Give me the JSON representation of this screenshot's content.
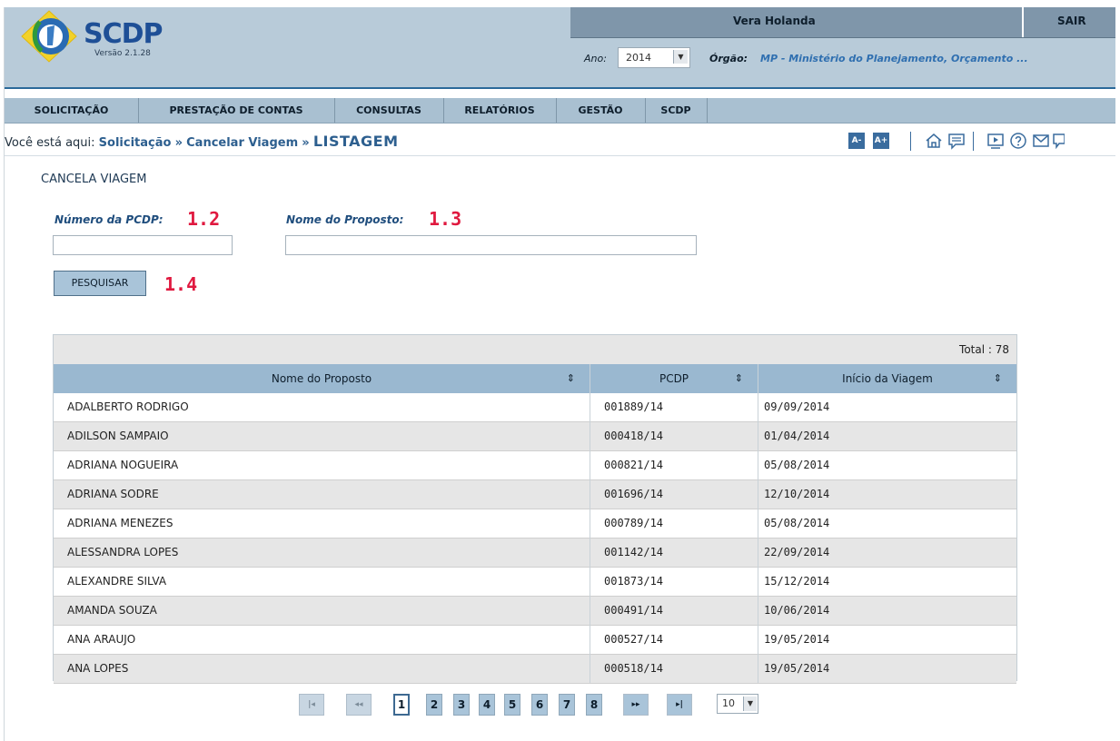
{
  "app": {
    "brand": "SCDP",
    "version": "Versão 2.1.28"
  },
  "user": {
    "name": "Vera Holanda",
    "logout": "SAIR"
  },
  "filters": {
    "ano_label": "Ano:",
    "ano_value": "2014",
    "orgao_label": "Órgão:",
    "orgao_value": "MP - Ministério do Planejamento, Orçamento ..."
  },
  "menu": [
    {
      "label": "SOLICITAÇÃO"
    },
    {
      "label": "PRESTAÇÃO DE CONTAS"
    },
    {
      "label": "CONSULTAS"
    },
    {
      "label": "RELATÓRIOS"
    },
    {
      "label": "GESTÃO"
    },
    {
      "label": "SCDP"
    }
  ],
  "breadcrumb": {
    "prefix": "Você está aqui:",
    "items": [
      "Solicitação",
      "Cancelar Viagem"
    ],
    "current": "LISTAGEM",
    "separator": "»"
  },
  "toolbar": {
    "font_decrease": "A-",
    "font_increase": "A+",
    "icons": [
      "home-icon",
      "chat-icon",
      "video-icon",
      "help-icon",
      "mail-icon",
      "feedback-icon"
    ]
  },
  "form": {
    "title": "CANCELA VIAGEM",
    "pcdp_label": "Número da PCDP:",
    "pcdp_value": "",
    "nome_label": "Nome do Proposto:",
    "nome_value": "",
    "search_button": "PESQUISAR"
  },
  "annotations": {
    "a12": "1.2",
    "a13": "1.3",
    "a14": "1.4"
  },
  "table": {
    "total": "Total : 78",
    "columns": [
      "Nome do Proposto",
      "PCDP",
      "Início da Viagem"
    ],
    "sort_icon": "⇕",
    "rows": [
      [
        "ADALBERTO RODRIGO",
        "001889/14",
        "09/09/2014"
      ],
      [
        "ADILSON SAMPAIO",
        "000418/14",
        "01/04/2014"
      ],
      [
        "ADRIANA NOGUEIRA",
        "000821/14",
        "05/08/2014"
      ],
      [
        "ADRIANA SODRE",
        "001696/14",
        "12/10/2014"
      ],
      [
        "ADRIANA MENEZES",
        "000789/14",
        "05/08/2014"
      ],
      [
        "ALESSANDRA LOPES",
        "001142/14",
        "22/09/2014"
      ],
      [
        "ALEXANDRE SILVA",
        "001873/14",
        "15/12/2014"
      ],
      [
        "AMANDA SOUZA",
        "000491/14",
        "10/06/2014"
      ],
      [
        "ANA ARAUJO",
        "000527/14",
        "19/05/2014"
      ],
      [
        "ANA LOPES",
        "000518/14",
        "19/05/2014"
      ]
    ]
  },
  "pager": {
    "first": "|◂",
    "prev": "◂◂",
    "pages": [
      "1",
      "2",
      "3",
      "4",
      "5",
      "6",
      "7",
      "8"
    ],
    "active_page": "1",
    "next": "▸▸",
    "last": "▸|",
    "page_size": "10"
  },
  "colors": {
    "header_bg": "#b8cbd9",
    "accent": "#2d5f8f",
    "annotation": "#e0193f"
  }
}
